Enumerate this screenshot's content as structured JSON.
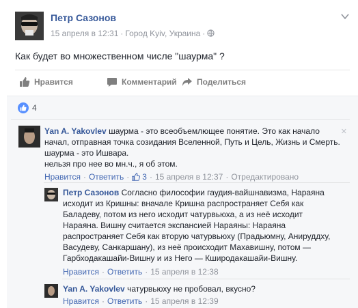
{
  "post": {
    "author": "Петр Сазонов",
    "date": "15 апреля в 12:31",
    "location": "Город Kyiv, Украина",
    "text": "Как будет во множественном числе \"шаурма\" ?"
  },
  "actions": {
    "like": "Нравится",
    "comment": "Комментарий",
    "share": "Поделиться"
  },
  "reactions": {
    "count": "4"
  },
  "comments": [
    {
      "author": "Yan A. Yakovlev",
      "lines": [
        "шаурма - это всеобъемлющее понятие. Это как начало",
        "начал, отправная точка созидания Вселенной, Путь и Цель, Жизнь и Смерть.",
        "шаурма - это Ишвара.",
        "нельзя про нее во мн.ч., я об этом."
      ],
      "like": "Нравится",
      "reply": "Ответить",
      "likes": "3",
      "date": "15 апреля в 12:37",
      "edited": "Отредактировано"
    },
    {
      "author": "Петр Сазонов",
      "lines": [
        "Согласно философии гаудия-вайшнавизма, Нараяна",
        "исходит из Кришны: вначале Кришна распространяет Себя как",
        "Баладеву, потом из него исходит чатурвьюха, а из неё исходит",
        "Нараяна. Вишну считается экспансией Нараяны: Нараяна",
        "распространяет Себя как вторую чатурвьюху (Прадьюмну, Анируддху,",
        "Васудеву, Санкаршану), из неё происходит Махавишну, потом —",
        "Гарбходакашайи-Вишну и из Него — Кширодакашайи-Вишну."
      ],
      "like": "Нравится",
      "reply": "Ответить",
      "date": "15 апреля в 12:38"
    },
    {
      "author": "Yan A. Yakovlev",
      "lines": [
        "чатурвьюху не пробовал, вкусно?"
      ],
      "like": "Нравится",
      "reply": "Ответить",
      "date": "15 апреля в 12:39"
    }
  ]
}
